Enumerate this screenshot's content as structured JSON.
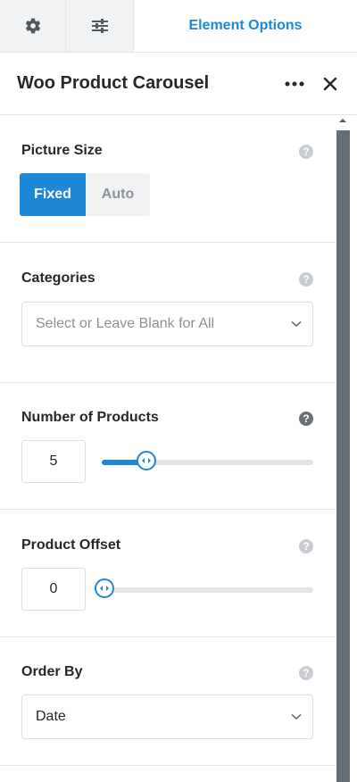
{
  "top_tabs": {
    "settings_icon": "gear-icon",
    "style_icon": "sliders-icon",
    "active_label": "Element Options"
  },
  "header": {
    "title": "Woo Product Carousel",
    "more_icon": "more-horizontal-icon",
    "close_icon": "close-icon"
  },
  "picture_size": {
    "label": "Picture Size",
    "options": [
      "Fixed",
      "Auto"
    ],
    "selected": "Fixed"
  },
  "categories": {
    "label": "Categories",
    "placeholder": "Select or Leave Blank for All"
  },
  "number_of_products": {
    "label": "Number of Products",
    "value": "5",
    "slider_fraction": 0.21
  },
  "product_offset": {
    "label": "Product Offset",
    "value": "0",
    "slider_fraction": 0.0
  },
  "order_by": {
    "label": "Order By",
    "value": "Date"
  },
  "help_symbol": "?",
  "colors": {
    "accent": "#1e88d8",
    "text": "#23282d",
    "muted": "#8d9297",
    "border": "#e2e4e7"
  }
}
